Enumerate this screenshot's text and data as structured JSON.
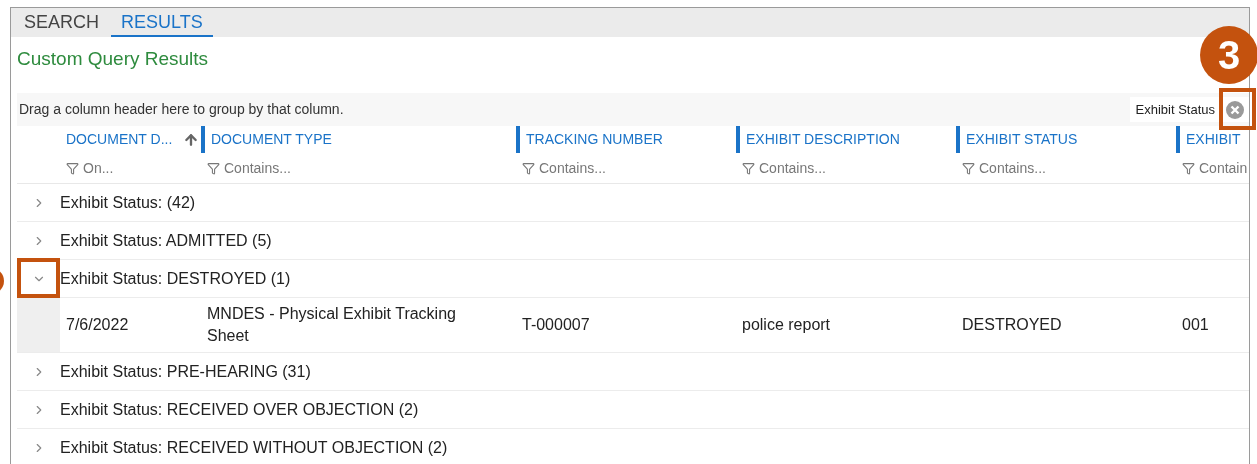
{
  "tabs": [
    {
      "label": "SEARCH",
      "selected": false
    },
    {
      "label": "RESULTS",
      "selected": true
    }
  ],
  "title": "Custom Query Results",
  "group_panel": {
    "hint": "Drag a column header here to group by that column.",
    "chips": [
      {
        "label": "Exhibit Status"
      }
    ]
  },
  "columns": [
    {
      "label": "DOCUMENT D...",
      "filter": "On...",
      "sorted": true
    },
    {
      "label": "DOCUMENT TYPE",
      "filter": "Contains...",
      "sorted": false
    },
    {
      "label": "TRACKING NUMBER",
      "filter": "Contains...",
      "sorted": false
    },
    {
      "label": "EXHIBIT DESCRIPTION",
      "filter": "Contains...",
      "sorted": false
    },
    {
      "label": "EXHIBIT STATUS",
      "filter": "Contains...",
      "sorted": false
    },
    {
      "label": "EXHIBIT",
      "filter": "Contain",
      "sorted": false
    }
  ],
  "groups": [
    {
      "label": "Exhibit Status: (42)",
      "expanded": false
    },
    {
      "label": "Exhibit Status: ADMITTED (5)",
      "expanded": false
    },
    {
      "label": "Exhibit Status: DESTROYED (1)",
      "expanded": true,
      "rows": [
        {
          "cells": [
            "7/6/2022",
            "MNDES - Physical Exhibit Tracking Sheet",
            "T-000007",
            "police report",
            "DESTROYED",
            "001"
          ]
        }
      ]
    },
    {
      "label": "Exhibit Status: PRE-HEARING (31)",
      "expanded": false
    },
    {
      "label": "Exhibit Status: RECEIVED OVER OBJECTION (2)",
      "expanded": false
    },
    {
      "label": "Exhibit Status: RECEIVED WITHOUT OBJECTION (2)",
      "expanded": false
    }
  ],
  "callouts": [
    {
      "label": "3"
    }
  ]
}
